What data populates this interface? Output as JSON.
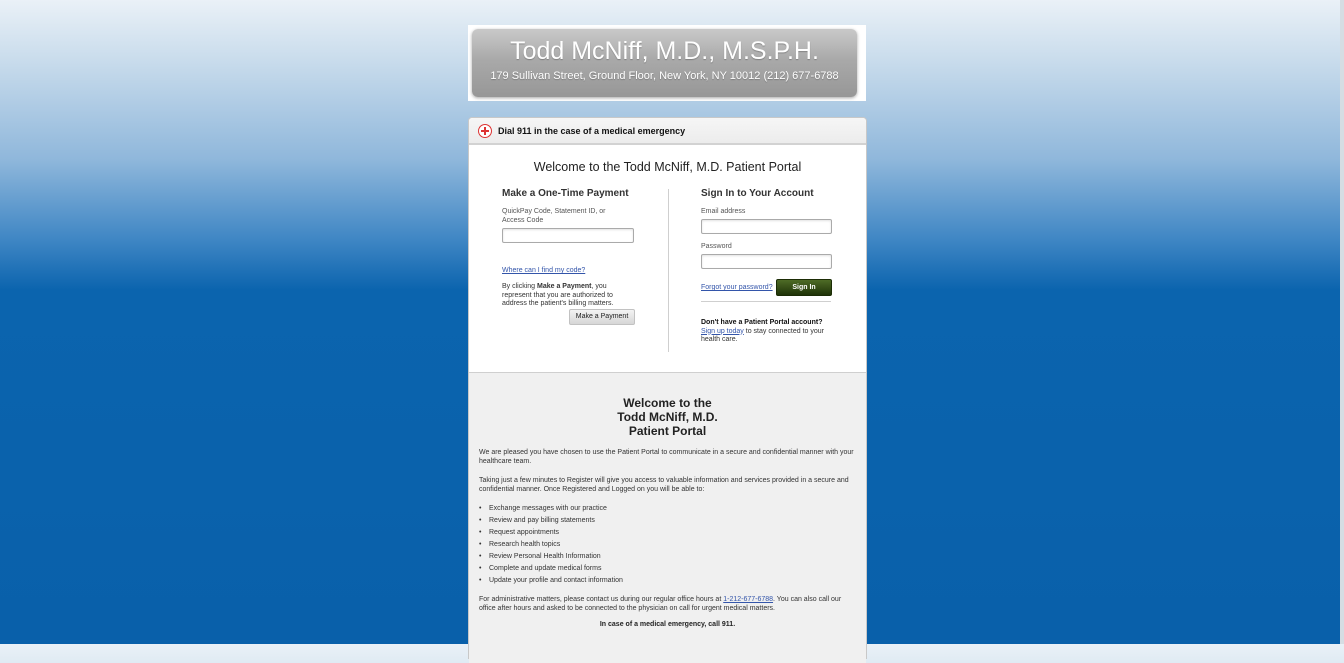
{
  "header": {
    "title": "Todd McNiff, M.D., M.S.P.H.",
    "address": "179 Sullivan Street, Ground Floor, New York, NY 10012   (212) 677-6788"
  },
  "emergency_bar": {
    "text": "Dial 911 in the case of a medical emergency"
  },
  "portal": {
    "welcome": "Welcome to the Todd McNiff, M.D. Patient Portal",
    "payment": {
      "heading": "Make a One-Time Payment",
      "code_label": "QuickPay Code, Statement ID, or Access Code",
      "code_value": "",
      "find_code_link": "Where can I find my code?",
      "disclaimer_prefix": "By clicking ",
      "disclaimer_bold": "Make a Payment",
      "disclaimer_suffix": ", you represent that you are authorized to address the patient's billing matters.",
      "button": "Make a Payment"
    },
    "signin": {
      "heading": "Sign In to Your Account",
      "email_label": "Email address",
      "email_value": "",
      "password_label": "Password",
      "password_value": "",
      "forgot_link": "Forgot your password?",
      "button": "Sign In",
      "no_account": "Don't have a Patient Portal account?",
      "signup_link": "Sign up today",
      "signup_suffix": " to stay connected to your health care."
    }
  },
  "info": {
    "title_line1": "Welcome to the",
    "title_line2": "Todd McNiff, M.D.",
    "title_line3": "Patient Portal",
    "para1": "We are pleased you have chosen to use the Patient Portal to communicate in a secure and confidential manner with your healthcare team.",
    "para2": "Taking just a few minutes to Register will give you access to valuable information and services provided in a secure and confidential manner. Once Registered and Logged on you will be able to:",
    "bullets": [
      "Exchange messages with our practice",
      "Review and pay billing statements",
      "Request appointments",
      "Research health topics",
      "Review Personal Health Information",
      "Complete and update medical forms",
      "Update your profile and contact information"
    ],
    "para3_prefix": "For administrative matters, please contact us during our regular office hours at ",
    "phone": "1-212-677-6788",
    "para3_suffix": ".  You can also call our office after hours and asked to be connected to the physician on call for urgent medical matters.",
    "closing": "In case of a medical emergency, call 911."
  }
}
